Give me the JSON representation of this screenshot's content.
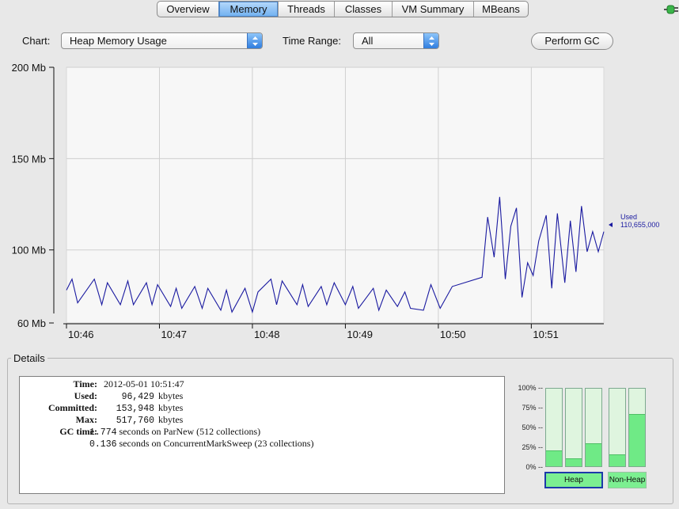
{
  "tabs": [
    {
      "label": "Overview",
      "active": false
    },
    {
      "label": "Memory",
      "active": true
    },
    {
      "label": "Threads",
      "active": false
    },
    {
      "label": "Classes",
      "active": false
    },
    {
      "label": "VM Summary",
      "active": false
    },
    {
      "label": "MBeans",
      "active": false
    }
  ],
  "toolbar": {
    "chart_label": "Chart:",
    "chart_value": "Heap Memory Usage",
    "time_range_label": "Time Range:",
    "time_range_value": "All",
    "gc_button": "Perform GC"
  },
  "chart_data": {
    "type": "line",
    "y_unit": "Mb",
    "yticks": [
      "200 Mb",
      "150 Mb",
      "100 Mb",
      "60 Mb"
    ],
    "ytick_values": [
      200,
      150,
      100,
      60
    ],
    "xticks": [
      "10:46",
      "10:47",
      "10:48",
      "10:49",
      "10:50",
      "10:51"
    ],
    "ylim": [
      60,
      200
    ],
    "xlim": [
      0,
      5.78
    ],
    "grid": true,
    "series": [
      {
        "name": "Used",
        "color": "#1a1aa0",
        "current_value": "110,655,000",
        "x": [
          0,
          0.06,
          0.12,
          0.3,
          0.38,
          0.44,
          0.58,
          0.66,
          0.72,
          0.86,
          0.92,
          0.98,
          1.12,
          1.18,
          1.24,
          1.38,
          1.46,
          1.52,
          1.66,
          1.72,
          1.78,
          1.92,
          2.0,
          2.06,
          2.2,
          2.26,
          2.32,
          2.48,
          2.54,
          2.6,
          2.74,
          2.8,
          2.88,
          3.0,
          3.08,
          3.14,
          3.3,
          3.36,
          3.44,
          3.56,
          3.64,
          3.7,
          3.84,
          3.92,
          4.02,
          4.15,
          4.47,
          4.53,
          4.6,
          4.66,
          4.72,
          4.78,
          4.84,
          4.9,
          4.96,
          5.02,
          5.08,
          5.16,
          5.22,
          5.28,
          5.36,
          5.42,
          5.48,
          5.54,
          5.6,
          5.66,
          5.72,
          5.78
        ],
        "y": [
          78,
          84,
          71,
          84,
          70,
          82,
          70,
          83,
          70,
          82,
          70,
          81,
          69,
          79,
          68,
          80,
          68,
          79,
          67,
          78,
          66,
          79,
          66,
          77,
          84,
          70,
          83,
          70,
          81,
          69,
          80,
          70,
          82,
          70,
          80,
          68,
          79,
          67,
          78,
          69,
          77,
          68,
          67,
          81,
          68,
          80,
          85,
          118,
          96,
          129,
          84,
          113,
          123,
          74,
          93,
          86,
          105,
          119,
          79,
          120,
          82,
          116,
          88,
          124,
          99,
          110,
          99,
          110
        ]
      }
    ]
  },
  "details": {
    "title": "Details",
    "time_label": "Time:",
    "time_value": "2012-05-01 10:51:47",
    "used_label": "Used:",
    "used_value": "96,429",
    "committed_label": "Committed:",
    "committed_value": "153,948",
    "max_label": "Max:",
    "max_value": "517,760",
    "unit": "kbytes",
    "gc_label": "GC time:",
    "gc1_value": "1.774",
    "gc1_text": "seconds on ParNew (512 collections)",
    "gc2_value": "0.136",
    "gc2_text": "seconds on ConcurrentMarkSweep (23 collections)"
  },
  "bars": {
    "pct_labels": [
      "100% --",
      "75% --",
      "50% --",
      "25% --",
      "0% --"
    ],
    "heap_fills": [
      0.2,
      0.1,
      0.3
    ],
    "nonheap_fills": [
      0.15,
      0.67
    ],
    "heap_label": "Heap",
    "nonheap_label": "Non-Heap",
    "fill_color": "#6fea86",
    "empty_color": "#dff5df"
  }
}
